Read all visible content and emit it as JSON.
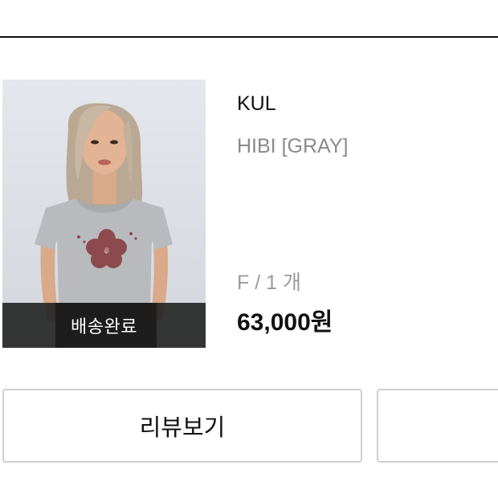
{
  "order_item": {
    "status_label": "배송완료",
    "brand": "KUL",
    "product_name": "HIBI [GRAY]",
    "option": "F / 1 개",
    "price": "63,000원",
    "image_icon": "product-photo"
  },
  "actions": {
    "review_label": "리뷰보기",
    "second_label": ""
  },
  "colors": {
    "text_primary": "#111111",
    "text_secondary": "#8a8a8a",
    "button_border": "#cfcfcf",
    "status_overlay": "#1e1e1e"
  }
}
